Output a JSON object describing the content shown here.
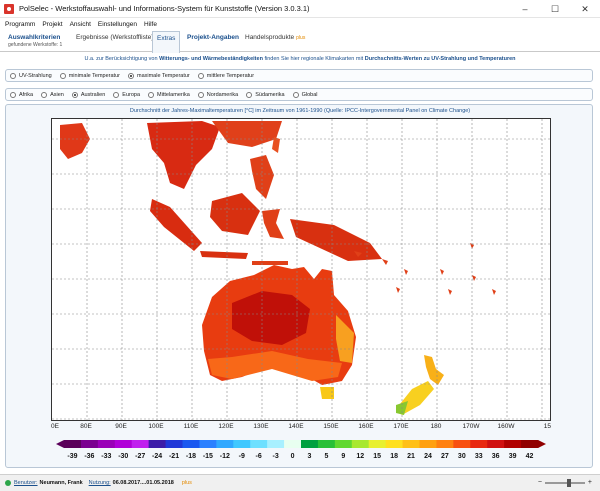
{
  "window": {
    "title": "PolSelec - Werkstoffauswahl- und Informations-System für Kunststoffe (Version 3.0.3.1)",
    "controls": [
      "–",
      "☐",
      "✕"
    ]
  },
  "menu": [
    "Programm",
    "Projekt",
    "Ansicht",
    "Einstellungen",
    "Hilfe"
  ],
  "tabs": {
    "auswahl": {
      "label": "Auswahlkriterien",
      "sub": "gefundene Werkstoffe: 1"
    },
    "ergebnisse": {
      "label": "Ergebnisse (Werkstoffliste)"
    },
    "extras": {
      "label": "Extras"
    },
    "projekt": {
      "label": "Projekt-Angaben"
    },
    "handel": {
      "label": "Handelsprodukte",
      "plus": "plus"
    }
  },
  "info": {
    "prefix": "U.a. zur Berücksichtigung von ",
    "bold1": "Witterungs- und Wärmebeständigkeiten",
    "mid": " finden Sie hier regionale Klimakarten mit ",
    "bold2": "Durchschnitts-Werten zu UV-Strahlung und Temperaturen"
  },
  "measure_options": [
    {
      "label": "UV-Strahlung",
      "selected": false
    },
    {
      "label": "minimale Temperatur",
      "selected": false
    },
    {
      "label": "maximale Temperatur",
      "selected": true
    },
    {
      "label": "mittlere Temperatur",
      "selected": false
    }
  ],
  "region_options": [
    {
      "label": "Afrika",
      "selected": false
    },
    {
      "label": "Asien",
      "selected": false
    },
    {
      "label": "Australien",
      "selected": true
    },
    {
      "label": "Europa",
      "selected": false
    },
    {
      "label": "Mittelamerika",
      "selected": false
    },
    {
      "label": "Nordamerika",
      "selected": false
    },
    {
      "label": "Südamerika",
      "selected": false
    },
    {
      "label": "Global",
      "selected": false
    }
  ],
  "map": {
    "caption": "Durchschnitt der Jahres-Maximaltemperaturen [°C] im Zeitraum von 1961-1990 (Quelle: IPCC-Intergovernmental Panel on Climate Change)",
    "lon_labels": [
      "0E",
      "80E",
      "90E",
      "100E",
      "110E",
      "120E",
      "130E",
      "140E",
      "150E",
      "160E",
      "170E",
      "180",
      "170W",
      "160W",
      "15"
    ],
    "colorbar_labels": [
      "-39",
      "-36",
      "-33",
      "-30",
      "-27",
      "-24",
      "-21",
      "-18",
      "-15",
      "-12",
      "-9",
      "-6",
      "-3",
      "0",
      "3",
      "5",
      "9",
      "12",
      "15",
      "18",
      "21",
      "24",
      "27",
      "30",
      "33",
      "36",
      "39",
      "42"
    ],
    "colorbar_colors": [
      "#5a005a",
      "#7a0090",
      "#9a00b8",
      "#b000d8",
      "#c020ee",
      "#3c1ca8",
      "#2038d8",
      "#1a58f0",
      "#2a80ff",
      "#30a8ff",
      "#40c8ff",
      "#6ee0ff",
      "#a8f0ff",
      "#e8fff0",
      "#00a040",
      "#28c038",
      "#60d830",
      "#a8e830",
      "#e8f030",
      "#ffe020",
      "#ffc018",
      "#ffa010",
      "#ff8010",
      "#f85010",
      "#e82810",
      "#d01010",
      "#b00000",
      "#900000"
    ]
  },
  "status": {
    "user_label": "Benutzer:",
    "user": "Neumann, Frank",
    "usage_label": "Nutzung:",
    "usage": "06.08.2017....01.05.2018",
    "plus": "plus"
  }
}
